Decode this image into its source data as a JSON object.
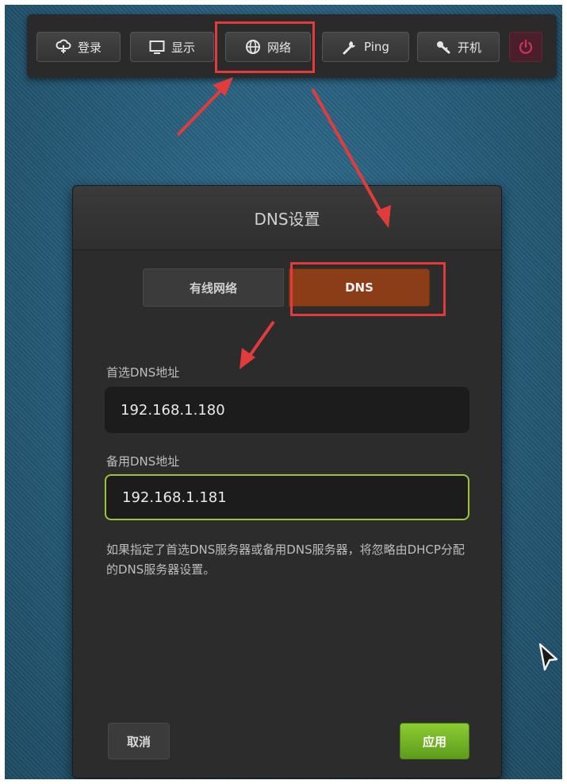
{
  "toolbar": {
    "buttons": [
      {
        "label": "登录",
        "icon": "cloud-icon"
      },
      {
        "label": "显示",
        "icon": "monitor-icon"
      },
      {
        "label": "网络",
        "icon": "globe-icon"
      },
      {
        "label": "Ping",
        "icon": "wrench-icon"
      },
      {
        "label": "开机",
        "icon": "key-icon"
      }
    ],
    "power_icon": "power-icon"
  },
  "dialog": {
    "title": "DNS设置",
    "tabs": [
      {
        "label": "有线网络",
        "active": false
      },
      {
        "label": "DNS",
        "active": true
      }
    ],
    "primary_dns": {
      "label": "首选DNS地址",
      "value": "192.168.1.180"
    },
    "secondary_dns": {
      "label": "备用DNS地址",
      "value": "192.168.1.181"
    },
    "hint": "如果指定了首选DNS服务器或备用DNS服务器，将忽略由DHCP分配的DNS服务器设置。",
    "cancel_label": "取消",
    "apply_label": "应用"
  },
  "colors": {
    "accent_tab": "#8a3d16",
    "apply_green": "#74b428",
    "focus_border": "#9cc43a",
    "annotation_red": "#e23b3b",
    "power_red": "#d0335a"
  }
}
